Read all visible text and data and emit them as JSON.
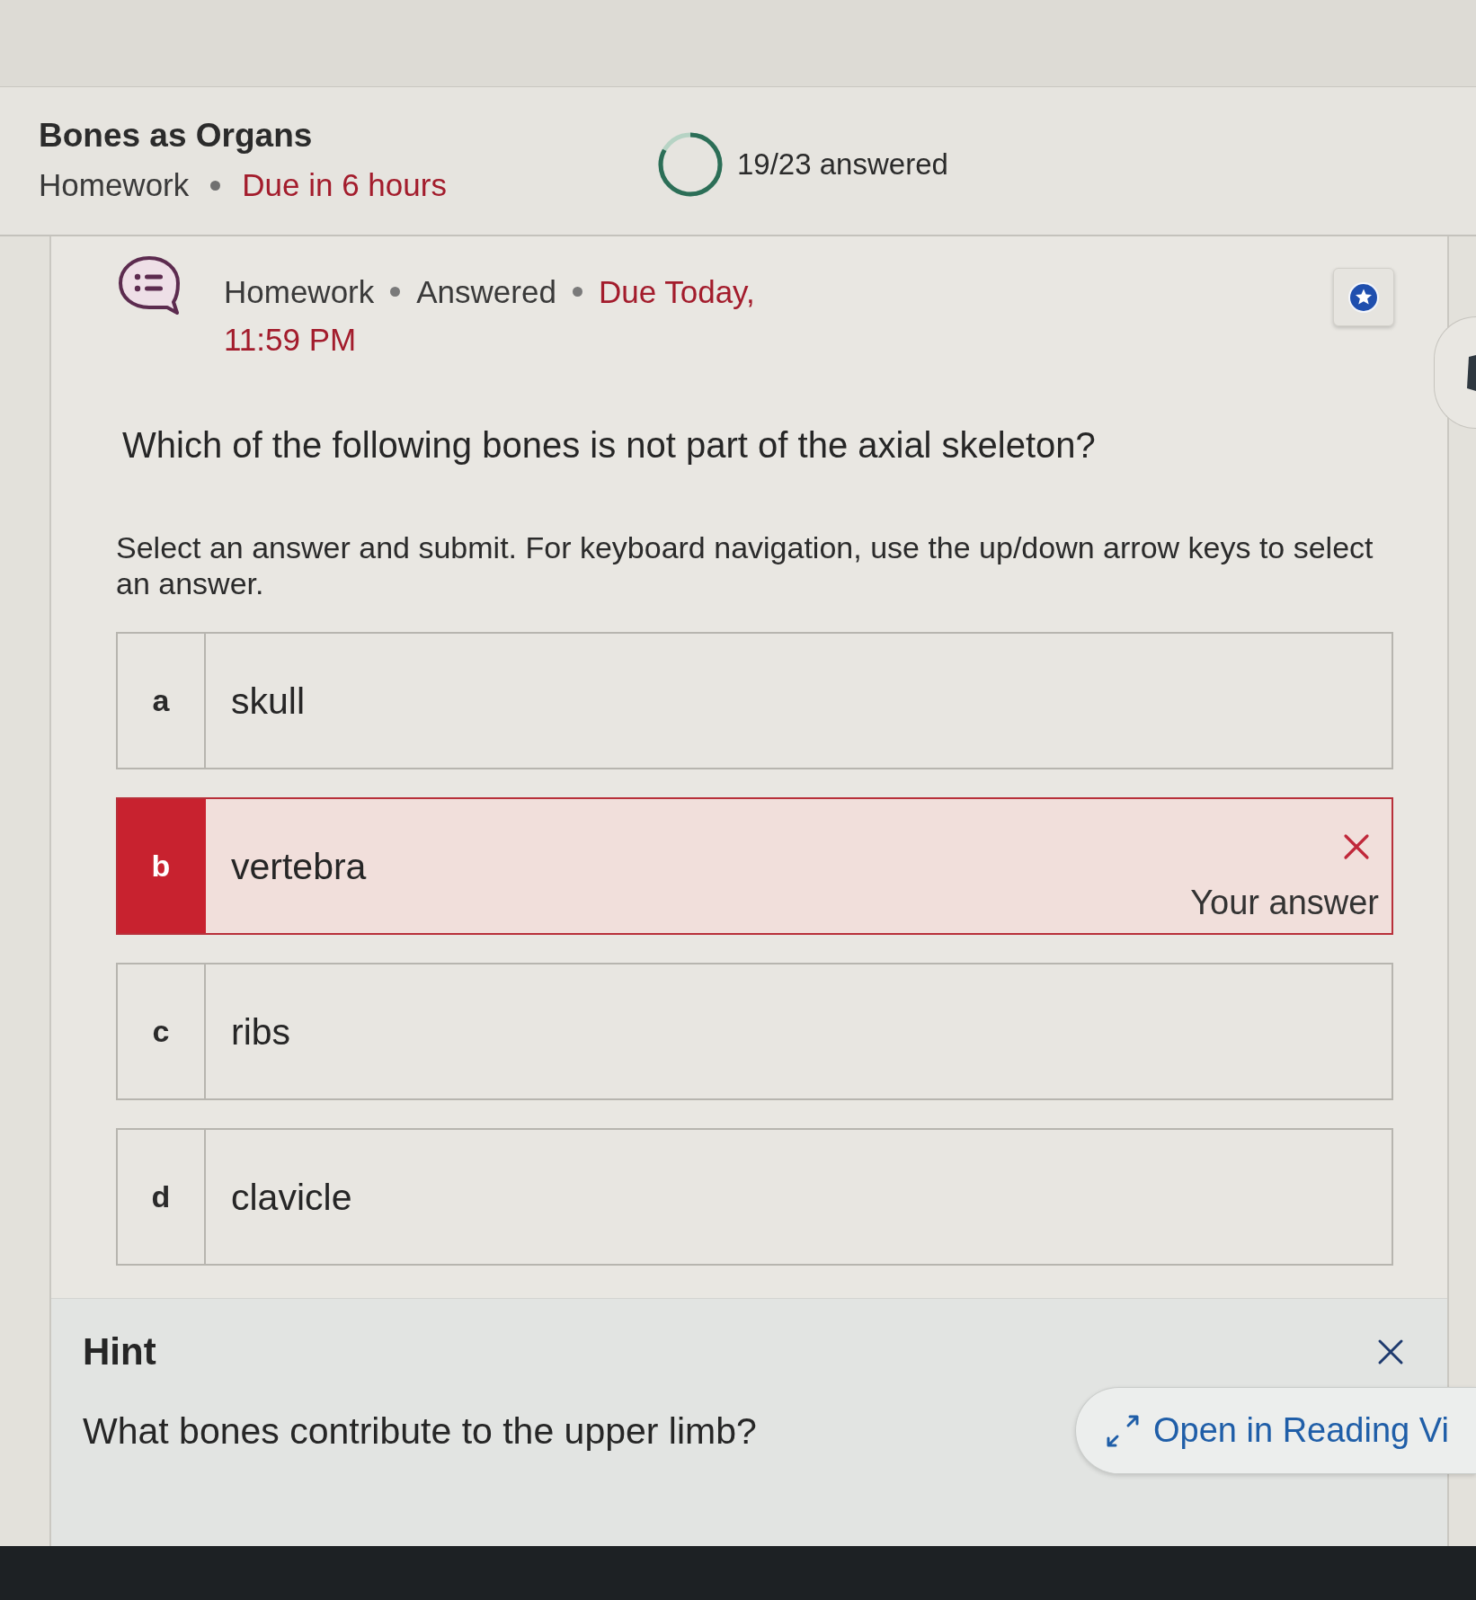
{
  "header": {
    "title": "Bones as Organs",
    "type": "Homework",
    "due": "Due in 6 hours",
    "progress": {
      "level": 0.83,
      "label": "19/23 answered"
    }
  },
  "question": {
    "meta": [
      "Homework",
      "Answered"
    ],
    "due_lines": [
      "Due Today,",
      "11:59 PM"
    ],
    "text": "Which of the following bones is not part of the axial skeleton?",
    "instructions": "Select an answer and submit. For keyboard navigation, use the up/down arrow keys to select an answer.",
    "answer_correct": false,
    "selected_label": "Your answer",
    "options": [
      {
        "letter": "a",
        "text": "skull",
        "selected": false
      },
      {
        "letter": "b",
        "text": "vertebra",
        "selected": true
      },
      {
        "letter": "c",
        "text": "ribs",
        "selected": false
      },
      {
        "letter": "d",
        "text": "clavicle",
        "selected": false
      }
    ]
  },
  "hint": {
    "title": "Hint",
    "text": "What bones contribute to the upper limb?",
    "reading_view_button": "Open in Reading Vi"
  }
}
